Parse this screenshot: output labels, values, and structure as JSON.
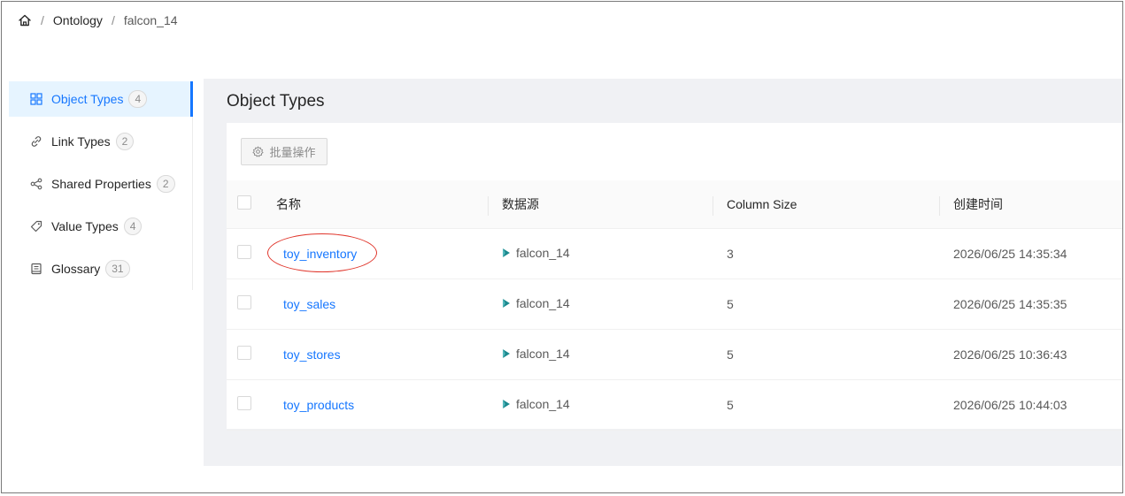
{
  "breadcrumb": {
    "home_icon": "home-icon",
    "items": [
      "Ontology",
      "falcon_14"
    ],
    "separator": "/"
  },
  "sidebar": {
    "items": [
      {
        "label": "Object Types",
        "count": "4",
        "icon": "grid-icon",
        "active": true
      },
      {
        "label": "Link Types",
        "count": "2",
        "icon": "link-icon",
        "active": false
      },
      {
        "label": "Shared Properties",
        "count": "2",
        "icon": "share-icon",
        "active": false
      },
      {
        "label": "Value Types",
        "count": "4",
        "icon": "tag-icon",
        "active": false
      },
      {
        "label": "Glossary",
        "count": "31",
        "icon": "book-icon",
        "active": false
      }
    ]
  },
  "main": {
    "title": "Object Types",
    "batch_button": "批量操作",
    "table": {
      "headers": [
        "名称",
        "数据源",
        "Column Size",
        "创建时间"
      ],
      "rows": [
        {
          "name": "toy_inventory",
          "source": "falcon_14",
          "columns": "3",
          "created": "2026/06/25 14:35:34"
        },
        {
          "name": "toy_sales",
          "source": "falcon_14",
          "columns": "5",
          "created": "2026/06/25 14:35:35"
        },
        {
          "name": "toy_stores",
          "source": "falcon_14",
          "columns": "5",
          "created": "2026/06/25 10:36:43"
        },
        {
          "name": "toy_products",
          "source": "falcon_14",
          "columns": "5",
          "created": "2026/06/25 10:44:03"
        }
      ]
    }
  },
  "colors": {
    "accent": "#1677ff",
    "active_bg": "#e6f4ff",
    "panel_bg": "#f0f1f4",
    "annotation": "#e0352b",
    "datasource_icon": "#1a8a8f"
  }
}
